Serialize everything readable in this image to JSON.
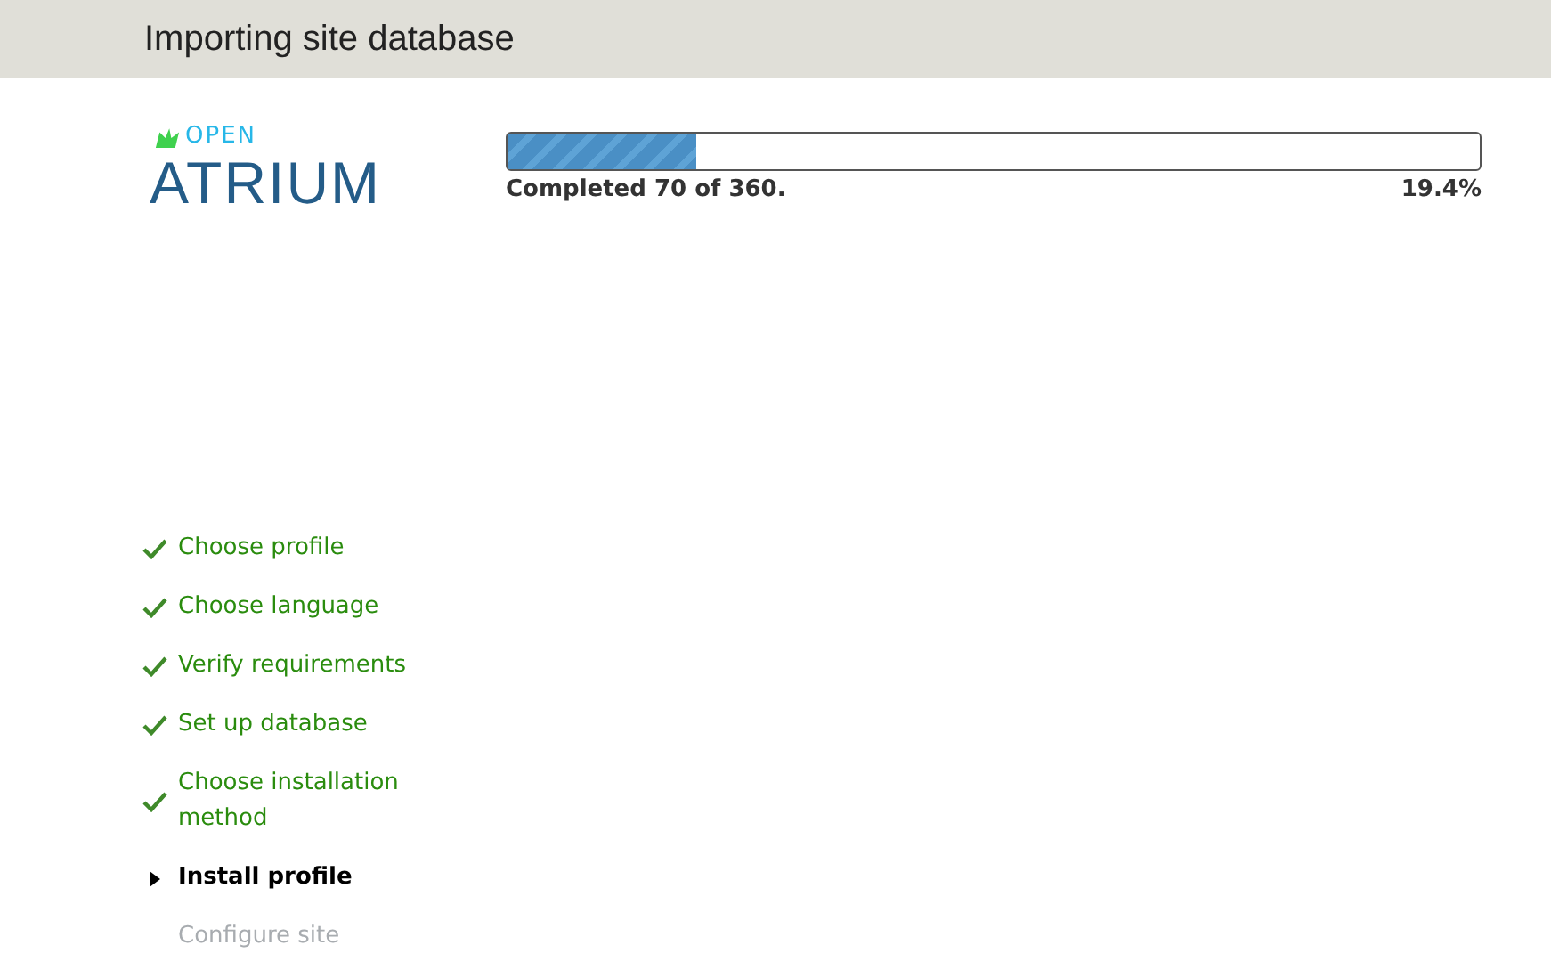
{
  "header": {
    "title": "Importing site database"
  },
  "logo": {
    "top_text": "OPEN",
    "main_text": "ATRIUM"
  },
  "progress": {
    "level": 0.194,
    "message": "Completed 70 of 360.",
    "percent": "19.4%"
  },
  "steps": [
    {
      "label": "Choose profile",
      "kind": "done"
    },
    {
      "label": "Choose language",
      "kind": "done"
    },
    {
      "label": "Verify requirements",
      "kind": "done"
    },
    {
      "label": "Set up database",
      "kind": "done"
    },
    {
      "label": "Choose installation method",
      "kind": "done"
    },
    {
      "label": "Install profile",
      "kind": "active"
    },
    {
      "label": "Configure site",
      "kind": "pending"
    }
  ]
}
